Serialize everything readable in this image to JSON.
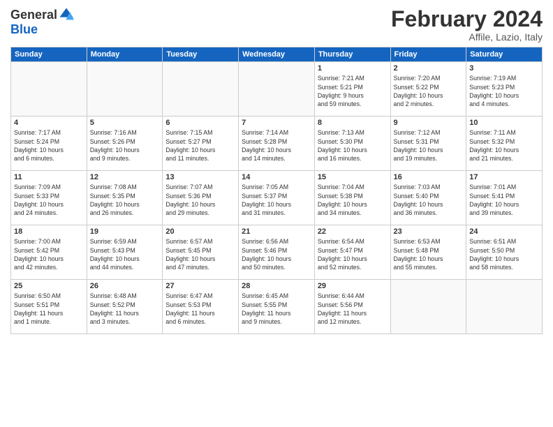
{
  "logo": {
    "general": "General",
    "blue": "Blue"
  },
  "header": {
    "month": "February 2024",
    "location": "Affile, Lazio, Italy"
  },
  "weekdays": [
    "Sunday",
    "Monday",
    "Tuesday",
    "Wednesday",
    "Thursday",
    "Friday",
    "Saturday"
  ],
  "weeks": [
    [
      {
        "day": "",
        "info": ""
      },
      {
        "day": "",
        "info": ""
      },
      {
        "day": "",
        "info": ""
      },
      {
        "day": "",
        "info": ""
      },
      {
        "day": "1",
        "info": "Sunrise: 7:21 AM\nSunset: 5:21 PM\nDaylight: 9 hours\nand 59 minutes."
      },
      {
        "day": "2",
        "info": "Sunrise: 7:20 AM\nSunset: 5:22 PM\nDaylight: 10 hours\nand 2 minutes."
      },
      {
        "day": "3",
        "info": "Sunrise: 7:19 AM\nSunset: 5:23 PM\nDaylight: 10 hours\nand 4 minutes."
      }
    ],
    [
      {
        "day": "4",
        "info": "Sunrise: 7:17 AM\nSunset: 5:24 PM\nDaylight: 10 hours\nand 6 minutes."
      },
      {
        "day": "5",
        "info": "Sunrise: 7:16 AM\nSunset: 5:26 PM\nDaylight: 10 hours\nand 9 minutes."
      },
      {
        "day": "6",
        "info": "Sunrise: 7:15 AM\nSunset: 5:27 PM\nDaylight: 10 hours\nand 11 minutes."
      },
      {
        "day": "7",
        "info": "Sunrise: 7:14 AM\nSunset: 5:28 PM\nDaylight: 10 hours\nand 14 minutes."
      },
      {
        "day": "8",
        "info": "Sunrise: 7:13 AM\nSunset: 5:30 PM\nDaylight: 10 hours\nand 16 minutes."
      },
      {
        "day": "9",
        "info": "Sunrise: 7:12 AM\nSunset: 5:31 PM\nDaylight: 10 hours\nand 19 minutes."
      },
      {
        "day": "10",
        "info": "Sunrise: 7:11 AM\nSunset: 5:32 PM\nDaylight: 10 hours\nand 21 minutes."
      }
    ],
    [
      {
        "day": "11",
        "info": "Sunrise: 7:09 AM\nSunset: 5:33 PM\nDaylight: 10 hours\nand 24 minutes."
      },
      {
        "day": "12",
        "info": "Sunrise: 7:08 AM\nSunset: 5:35 PM\nDaylight: 10 hours\nand 26 minutes."
      },
      {
        "day": "13",
        "info": "Sunrise: 7:07 AM\nSunset: 5:36 PM\nDaylight: 10 hours\nand 29 minutes."
      },
      {
        "day": "14",
        "info": "Sunrise: 7:05 AM\nSunset: 5:37 PM\nDaylight: 10 hours\nand 31 minutes."
      },
      {
        "day": "15",
        "info": "Sunrise: 7:04 AM\nSunset: 5:38 PM\nDaylight: 10 hours\nand 34 minutes."
      },
      {
        "day": "16",
        "info": "Sunrise: 7:03 AM\nSunset: 5:40 PM\nDaylight: 10 hours\nand 36 minutes."
      },
      {
        "day": "17",
        "info": "Sunrise: 7:01 AM\nSunset: 5:41 PM\nDaylight: 10 hours\nand 39 minutes."
      }
    ],
    [
      {
        "day": "18",
        "info": "Sunrise: 7:00 AM\nSunset: 5:42 PM\nDaylight: 10 hours\nand 42 minutes."
      },
      {
        "day": "19",
        "info": "Sunrise: 6:59 AM\nSunset: 5:43 PM\nDaylight: 10 hours\nand 44 minutes."
      },
      {
        "day": "20",
        "info": "Sunrise: 6:57 AM\nSunset: 5:45 PM\nDaylight: 10 hours\nand 47 minutes."
      },
      {
        "day": "21",
        "info": "Sunrise: 6:56 AM\nSunset: 5:46 PM\nDaylight: 10 hours\nand 50 minutes."
      },
      {
        "day": "22",
        "info": "Sunrise: 6:54 AM\nSunset: 5:47 PM\nDaylight: 10 hours\nand 52 minutes."
      },
      {
        "day": "23",
        "info": "Sunrise: 6:53 AM\nSunset: 5:48 PM\nDaylight: 10 hours\nand 55 minutes."
      },
      {
        "day": "24",
        "info": "Sunrise: 6:51 AM\nSunset: 5:50 PM\nDaylight: 10 hours\nand 58 minutes."
      }
    ],
    [
      {
        "day": "25",
        "info": "Sunrise: 6:50 AM\nSunset: 5:51 PM\nDaylight: 11 hours\nand 1 minute."
      },
      {
        "day": "26",
        "info": "Sunrise: 6:48 AM\nSunset: 5:52 PM\nDaylight: 11 hours\nand 3 minutes."
      },
      {
        "day": "27",
        "info": "Sunrise: 6:47 AM\nSunset: 5:53 PM\nDaylight: 11 hours\nand 6 minutes."
      },
      {
        "day": "28",
        "info": "Sunrise: 6:45 AM\nSunset: 5:55 PM\nDaylight: 11 hours\nand 9 minutes."
      },
      {
        "day": "29",
        "info": "Sunrise: 6:44 AM\nSunset: 5:56 PM\nDaylight: 11 hours\nand 12 minutes."
      },
      {
        "day": "",
        "info": ""
      },
      {
        "day": "",
        "info": ""
      }
    ]
  ]
}
